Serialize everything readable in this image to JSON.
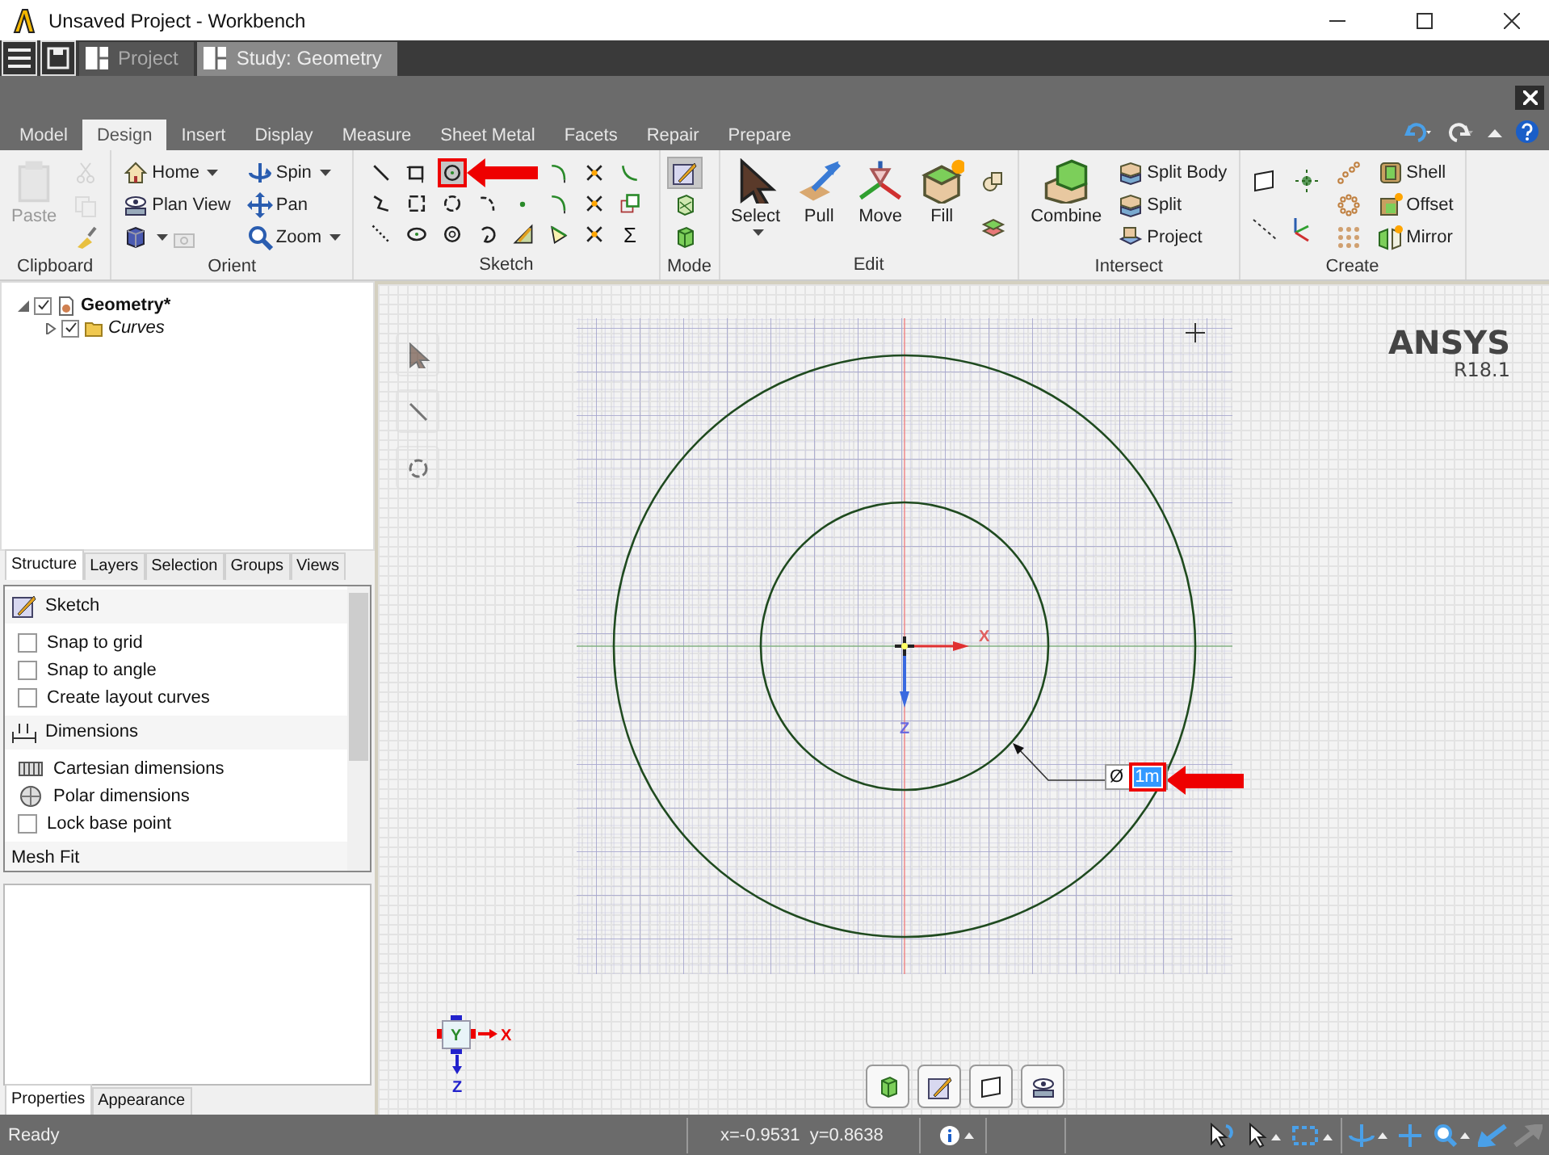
{
  "window": {
    "title": "Unsaved Project - Workbench"
  },
  "workbench_tabs": [
    {
      "label": "Project",
      "selected": false
    },
    {
      "label": "Study: Geometry",
      "selected": true
    }
  ],
  "ribbon": {
    "tabs": [
      {
        "label": "Model",
        "selected": false
      },
      {
        "label": "Design",
        "selected": true
      },
      {
        "label": "Insert",
        "selected": false
      },
      {
        "label": "Display",
        "selected": false
      },
      {
        "label": "Measure",
        "selected": false
      },
      {
        "label": "Sheet Metal",
        "selected": false
      },
      {
        "label": "Facets",
        "selected": false
      },
      {
        "label": "Repair",
        "selected": false
      },
      {
        "label": "Prepare",
        "selected": false
      }
    ],
    "groups": [
      {
        "label": "Clipboard",
        "kind": "columns",
        "columns": [
          {
            "kind": "large",
            "items": [
              {
                "label": "Paste",
                "disabled": true
              }
            ]
          },
          {
            "kind": "stack",
            "items": [
              {
                "disabled": true
              },
              {
                "disabled": true
              },
              {
                "disabled": false
              }
            ]
          }
        ]
      },
      {
        "label": "Orient",
        "kind": "columns",
        "columns": [
          {
            "kind": "stack",
            "items": [
              {
                "label": "Home",
                "dropdown": true
              },
              {
                "label": "Plan View",
                "dropdown": false
              },
              {
                "dropdown": true
              }
            ]
          },
          {
            "kind": "stack",
            "items": [
              {
                "label": "Spin",
                "dropdown": true
              },
              {
                "label": "Pan",
                "dropdown": false
              },
              {
                "label": "Zoom",
                "dropdown": true
              }
            ]
          }
        ]
      },
      {
        "label": "Sketch",
        "kind": "grid",
        "tools": [
          {
            "kind": "line",
            "selected": false
          },
          {
            "kind": "rectangle",
            "selected": false
          },
          {
            "kind": "circle",
            "selected": true
          },
          {
            "kind": "corner-arc",
            "selected": false
          },
          {
            "kind": "cross",
            "selected": false
          },
          {
            "kind": "curve",
            "selected": false
          },
          {
            "kind": "polyline",
            "selected": false
          },
          {
            "kind": "square",
            "selected": false
          },
          {
            "kind": "ring",
            "selected": false
          },
          {
            "kind": "hook",
            "selected": false
          },
          {
            "kind": "dot",
            "selected": false
          },
          {
            "kind": "corner-arc",
            "selected": false
          },
          {
            "kind": "cross",
            "selected": false
          },
          {
            "kind": "offset-rect",
            "selected": false
          },
          {
            "kind": "dotted-line",
            "selected": false
          },
          {
            "kind": "ellipse",
            "selected": false
          },
          {
            "kind": "circle-dot",
            "selected": false
          },
          {
            "kind": "spiral",
            "selected": false
          },
          {
            "kind": "pencil-triangle",
            "selected": false
          },
          {
            "kind": "polygon",
            "selected": false
          },
          {
            "kind": "cross",
            "selected": false
          },
          {
            "kind": "symbol",
            "label": "Σ",
            "selected": false
          }
        ]
      },
      {
        "label": "Mode",
        "kind": "columns",
        "columns": [
          {
            "kind": "stack",
            "items": [
              {
                "selected": true
              },
              {
                "selected": false
              },
              {
                "selected": false
              }
            ]
          }
        ]
      },
      {
        "label": "Edit",
        "kind": "columns",
        "columns": [
          {
            "kind": "large",
            "items": [
              {
                "label": "Select",
                "dropdown": true
              }
            ]
          },
          {
            "kind": "large",
            "items": [
              {
                "label": "Pull"
              }
            ]
          },
          {
            "kind": "large",
            "items": [
              {
                "label": "Move"
              }
            ]
          },
          {
            "kind": "large",
            "items": [
              {
                "label": "Fill"
              }
            ]
          },
          {
            "kind": "stack",
            "items": [
              {
                "disabled": false
              },
              {
                "disabled": false
              }
            ]
          }
        ]
      },
      {
        "label": "Intersect",
        "kind": "columns",
        "columns": [
          {
            "kind": "large",
            "items": [
              {
                "label": "Combine"
              }
            ]
          },
          {
            "kind": "stack",
            "items": [
              {
                "label": "Split Body"
              },
              {
                "label": "Split"
              },
              {
                "label": "Project"
              }
            ]
          }
        ]
      },
      {
        "label": "Create",
        "kind": "columns",
        "columns": [
          {
            "kind": "stack",
            "items": [
              {
                "disabled": false
              },
              {
                "disabled": false
              }
            ]
          },
          {
            "kind": "stack",
            "items": [
              {
                "disabled": false
              },
              {
                "disabled": false
              }
            ]
          },
          {
            "kind": "stack",
            "items": [
              {
                "disabled": false
              },
              {
                "disabled": false
              },
              {
                "disabled": false
              }
            ]
          },
          {
            "kind": "stack",
            "items": [
              {
                "label": "Shell"
              },
              {
                "label": "Offset"
              },
              {
                "label": "Mirror"
              }
            ]
          }
        ]
      }
    ]
  },
  "structure_tree": [
    {
      "label": "Geometry*",
      "kind": "part",
      "checked": true,
      "expanded": true,
      "children": [
        {
          "label": "Curves",
          "kind": "folder",
          "checked": true,
          "expanded": false
        }
      ]
    }
  ],
  "panel_tabs": [
    {
      "label": "Structure",
      "selected": true
    },
    {
      "label": "Layers",
      "selected": false
    },
    {
      "label": "Selection",
      "selected": false
    },
    {
      "label": "Groups",
      "selected": false
    },
    {
      "label": "Views",
      "selected": false
    }
  ],
  "options": [
    {
      "kind": "header",
      "label": "Sketch"
    },
    {
      "kind": "checkbox",
      "label": "Snap to grid",
      "checked": false
    },
    {
      "kind": "checkbox",
      "label": "Snap to angle",
      "checked": false
    },
    {
      "kind": "checkbox",
      "label": "Create layout curves",
      "checked": false
    },
    {
      "kind": "header",
      "label": "Dimensions"
    },
    {
      "kind": "option",
      "label": "Cartesian dimensions"
    },
    {
      "kind": "option",
      "label": "Polar dimensions"
    },
    {
      "kind": "checkbox",
      "label": "Lock base point",
      "checked": false
    },
    {
      "kind": "header",
      "label": "Mesh Fit"
    }
  ],
  "properties_tabs": [
    {
      "label": "Properties",
      "selected": true
    },
    {
      "label": "Appearance",
      "selected": false
    }
  ],
  "viewport": {
    "logo": "ANSYS",
    "version": "R18.1",
    "sketch_axes": {
      "x": "X",
      "z": "Z"
    },
    "dimension": {
      "symbol": "Ø",
      "value": "1m"
    },
    "triad": {
      "y": "Y",
      "x": "X",
      "z": "Z"
    }
  },
  "status_bar": {
    "message": "Ready",
    "coordinates": "x=-0.9531  y=0.8638"
  }
}
